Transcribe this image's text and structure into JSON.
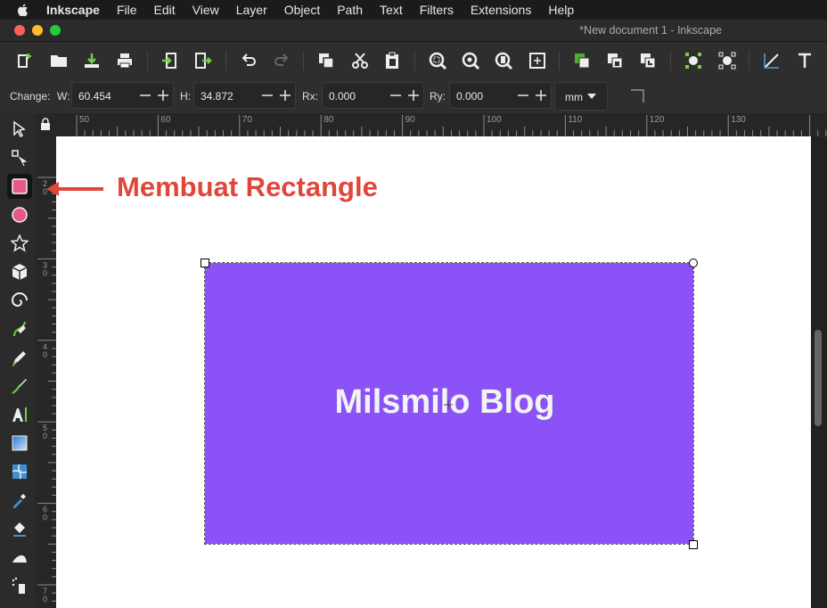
{
  "menubar": {
    "app": "Inkscape",
    "items": [
      "File",
      "Edit",
      "View",
      "Layer",
      "Object",
      "Path",
      "Text",
      "Filters",
      "Extensions",
      "Help"
    ]
  },
  "window": {
    "title": "*New document 1 - Inkscape"
  },
  "toolbar": {
    "icons": [
      "new-document-icon",
      "open-icon",
      "save-icon",
      "print-icon",
      "import-icon",
      "export-icon",
      "undo-icon",
      "redo-icon",
      "copy-icon",
      "cut-icon",
      "paste-icon",
      "zoom-selection-icon",
      "zoom-drawing-icon",
      "zoom-page-icon",
      "zoom-resize-page-icon",
      "duplicate-icon",
      "clone-icon",
      "unlink-clone-icon",
      "group-icon",
      "ungroup-icon",
      "edit-node-icon",
      "text-tool-icon"
    ]
  },
  "controls": {
    "change_label": "Change:",
    "w_label": "W:",
    "w_value": "60.454",
    "h_label": "H:",
    "h_value": "34.872",
    "rx_label": "Rx:",
    "rx_value": "0.000",
    "ry_label": "Ry:",
    "ry_value": "0.000",
    "unit": "mm"
  },
  "tools": [
    "selector-tool",
    "node-tool",
    "rectangle-tool",
    "ellipse-tool",
    "star-tool",
    "3d-box-tool",
    "spiral-tool",
    "pen-tool",
    "pencil-tool",
    "calligraphy-tool",
    "text-tool",
    "gradient-tool",
    "mesh-tool",
    "dropper-tool",
    "paint-bucket-tool",
    "tweak-tool",
    "spray-tool"
  ],
  "active_tool": "rectangle-tool",
  "ruler": {
    "h_labels": [
      "50",
      "60",
      "70",
      "80",
      "90",
      "100",
      "110",
      "120",
      "130"
    ],
    "v_labels": [
      "2\n0",
      "3\n0",
      "4\n0",
      "5\n0",
      "6\n0",
      "7\n0"
    ]
  },
  "canvas": {
    "rect_color": "#8b52f7",
    "rect_text": "Milsmilo Blog"
  },
  "annotation": {
    "text": "Membuat Rectangle",
    "color": "#e0463a"
  },
  "colors": {
    "accent": "#e0463a",
    "selected_tool_fill": "#e8588a"
  }
}
